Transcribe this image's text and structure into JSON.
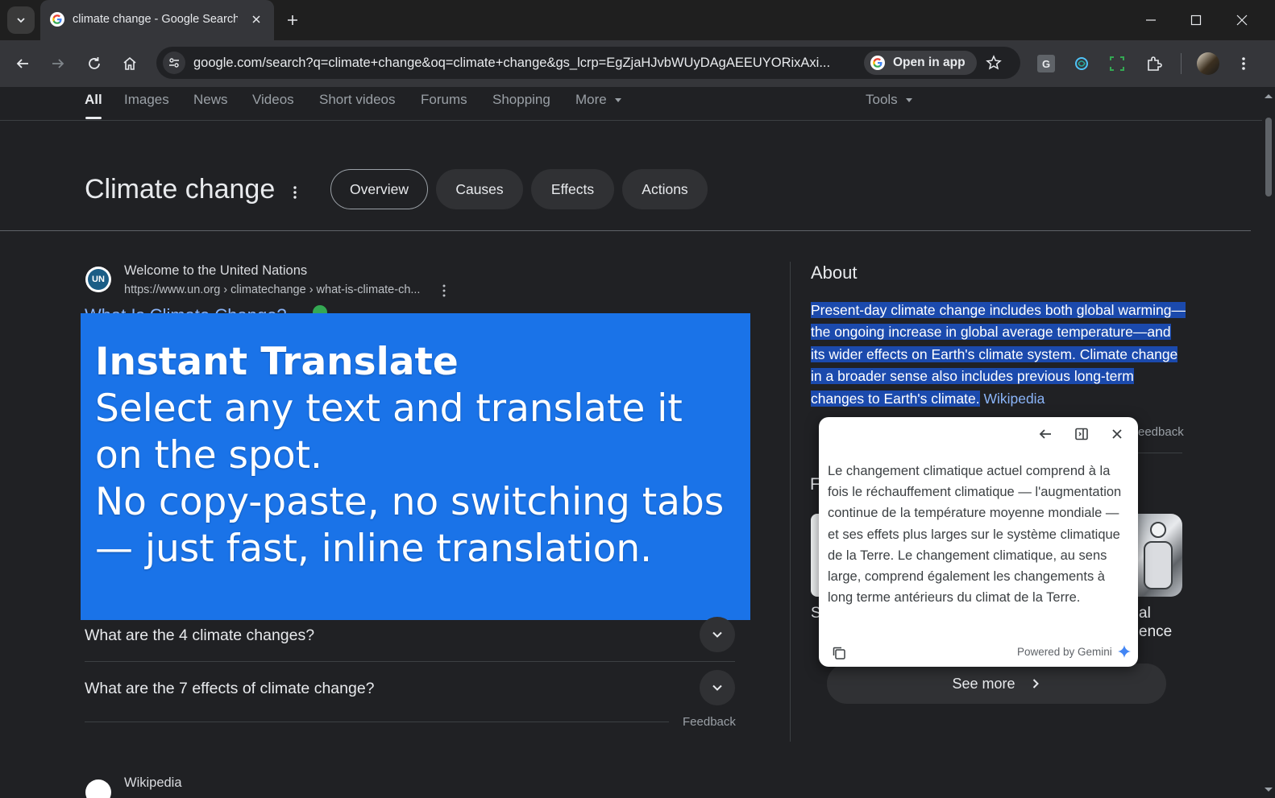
{
  "browser": {
    "tab_title": "climate change - Google Search",
    "url": "google.com/search?q=climate+change&oq=climate+change&gs_lcrp=EgZjaHJvbWUyDAgAEEUYORixAxi...",
    "open_in_app_label": "Open in app"
  },
  "search_nav": {
    "tabs": [
      "All",
      "Images",
      "News",
      "Videos",
      "Short videos",
      "Forums",
      "Shopping",
      "More"
    ],
    "tools_label": "Tools"
  },
  "topic": {
    "title": "Climate change",
    "chips": [
      "Overview",
      "Causes",
      "Effects",
      "Actions"
    ]
  },
  "result": {
    "site_name": "Welcome to the United Nations",
    "url": "https://www.un.org › climatechange › what-is-climate-ch...",
    "title": "What Is Climate Change?",
    "favicon_text": "UN"
  },
  "promo": {
    "title": "Instant Translate",
    "body": "Select any text and translate it on the spot.\n No copy-paste, no switching tabs — just fast, inline translation."
  },
  "faq": {
    "questions": [
      "What are the 4 climate changes?",
      "What are the 7 effects of climate change?"
    ],
    "feedback_label": "Feedback"
  },
  "about": {
    "heading": "About",
    "lines": [
      "Present-day climate change includes both global warming—",
      "the ongoing increase in global average temperature—and",
      "its wider effects on Earth's climate system. Climate change",
      "in a broader sense also includes previous long-term",
      "changes to Earth's climate."
    ],
    "source_link": "Wikipedia",
    "feedback_fragment": "eedback"
  },
  "knowledge_fragments": {
    "left_letter_1": "F",
    "left_letter_2": "S",
    "right_line_1": "al",
    "right_line_2": "ence"
  },
  "see_more_label": "See more",
  "translate_popup": {
    "translation": "Le changement climatique actuel comprend à la fois le réchauffement climatique — l'augmentation continue de la température moyenne mondiale — et ses effets plus larges sur le système climatique de la Terre. Le changement climatique, au sens large, comprend également les changements à long terme antérieurs du climat de la Terre.",
    "powered_by": "Powered by Gemini"
  },
  "colors": {
    "page_bg": "#202124",
    "promo_bg": "#1a73e8",
    "link": "#8ab4f8",
    "selection": "#1b4aad"
  },
  "next_result": {
    "site_name": "Wikipedia"
  }
}
